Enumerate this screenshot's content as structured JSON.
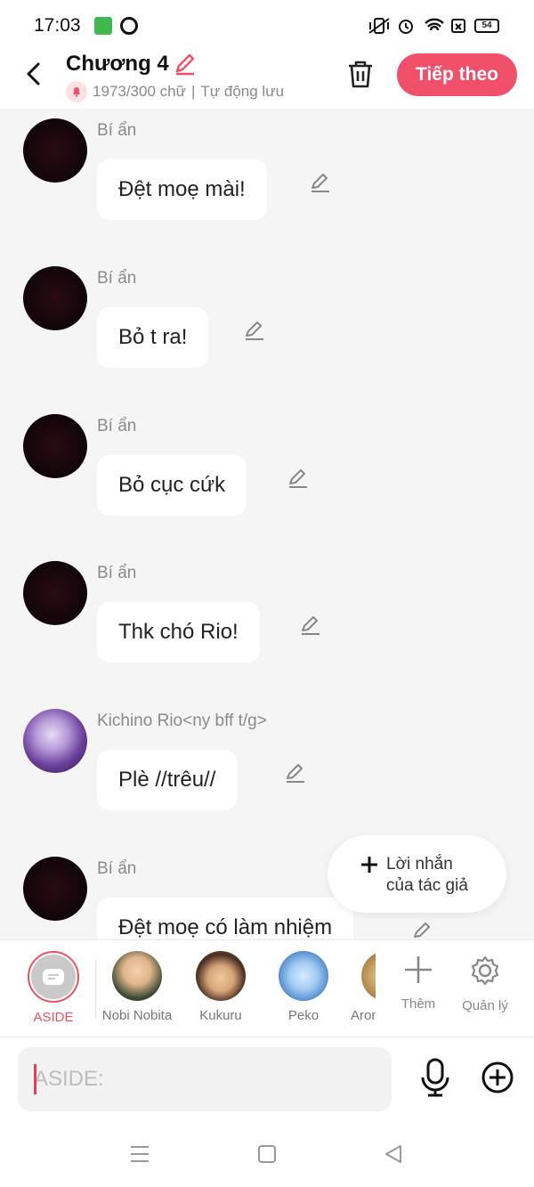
{
  "status": {
    "time": "17:03",
    "battery": "54"
  },
  "header": {
    "title": "Chương 4",
    "word_count": "1973/300 chữ",
    "separator": "|",
    "autosave": "Tự động lưu",
    "next_label": "Tiếp theo"
  },
  "messages": [
    {
      "sender": "Bí ẩn",
      "text": "Đệt moẹ mài!"
    },
    {
      "sender": "Bí ẩn",
      "text": "Bỏ t ra!"
    },
    {
      "sender": "Bí ẩn",
      "text": "Bỏ cục cứk"
    },
    {
      "sender": "Bí ẩn",
      "text": "Thk chó Rio!"
    },
    {
      "sender": "Kichino Rio<ny bff t/g>",
      "text": "Plè //trêu//"
    },
    {
      "sender": "Bí ẩn",
      "text": "Đệt moẹ có làm nhiệm"
    }
  ],
  "author_note": {
    "line1": "Lời nhắn",
    "line2": "của tác giả"
  },
  "characters": [
    {
      "name": "ASIDE"
    },
    {
      "name": "Nobi Nobita"
    },
    {
      "name": "Kukuru"
    },
    {
      "name": "Peko"
    },
    {
      "name": "Aron"
    }
  ],
  "tools": {
    "add_label": "Thêm",
    "manage_label": "Quản lý"
  },
  "input": {
    "placeholder": "ASIDE:"
  },
  "colors": {
    "accent": "#f0506a",
    "background": "#f5f5f5"
  },
  "icons": [
    "back-arrow-icon",
    "edit-pencil-icon",
    "bell-icon",
    "trash-icon",
    "plus-icon",
    "gear-icon",
    "microphone-icon",
    "add-circle-icon",
    "menu-icon",
    "home-square-icon",
    "back-triangle-icon"
  ]
}
